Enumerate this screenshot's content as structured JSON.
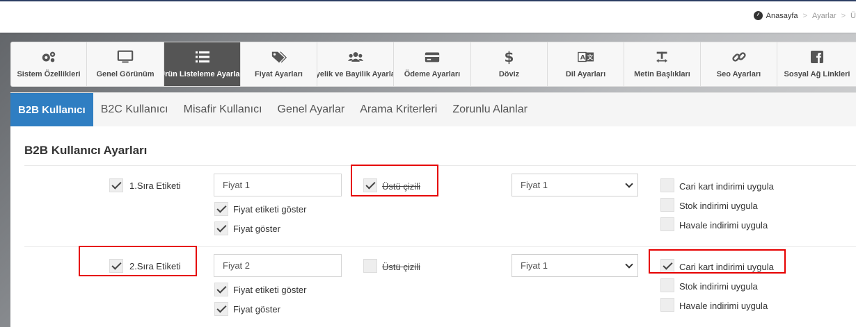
{
  "breadcrumb": {
    "home": "Anasayfa",
    "sep": ">",
    "item1": "Ayarlar",
    "item2": "Ü"
  },
  "toolbar": {
    "items": [
      {
        "label": "Sistem Özellikleri",
        "icon": "gears-icon"
      },
      {
        "label": "Genel Görünüm",
        "icon": "monitor-icon"
      },
      {
        "label": "Ürün Listeleme Ayarları",
        "icon": "list-icon"
      },
      {
        "label": "Fiyat Ayarları",
        "icon": "tags-icon"
      },
      {
        "label": "Üyelik ve Bayilik Ayarları",
        "icon": "users-icon"
      },
      {
        "label": "Ödeme Ayarları",
        "icon": "credit-card-icon"
      },
      {
        "label": "Döviz",
        "icon": "dollar-icon"
      },
      {
        "label": "Dil Ayarları",
        "icon": "language-icon"
      },
      {
        "label": "Metin Başlıkları",
        "icon": "text-height-icon"
      },
      {
        "label": "Seo Ayarları",
        "icon": "link-icon"
      },
      {
        "label": "Sosyal Ağ Linkleri",
        "icon": "facebook-icon"
      }
    ],
    "active_index": 2
  },
  "tabs": [
    "B2B Kullanıcı",
    "B2C Kullanıcı",
    "Misafir Kullanıcı",
    "Genel Ayarlar",
    "Arama Kriterleri",
    "Zorunlu Alanlar"
  ],
  "section_title": "B2B Kullanıcı Ayarları",
  "rows": [
    {
      "label_check": {
        "label": "1.Sıra Etiketi",
        "checked": true
      },
      "input_value": "Fiyat 1",
      "show_label": {
        "label": "Fiyat etiketi göster",
        "checked": true
      },
      "show_price": {
        "label": "Fiyat göster",
        "checked": true
      },
      "strike": {
        "label": "Üstü çizili",
        "checked": true
      },
      "select_value": "Fiyat 1",
      "discounts": [
        {
          "label": "Cari kart indirimi uygula",
          "checked": false
        },
        {
          "label": "Stok indirimi uygula",
          "checked": false
        },
        {
          "label": "Havale indirimi uygula",
          "checked": false
        }
      ]
    },
    {
      "label_check": {
        "label": "2.Sıra Etiketi",
        "checked": true
      },
      "input_value": "Fiyat 2",
      "show_label": {
        "label": "Fiyat etiketi göster",
        "checked": true
      },
      "show_price": {
        "label": "Fiyat göster",
        "checked": true
      },
      "strike": {
        "label": "Üstü çizili",
        "checked": false
      },
      "select_value": "Fiyat 1",
      "discounts": [
        {
          "label": "Cari kart indirimi uygula",
          "checked": true
        },
        {
          "label": "Stok indirimi uygula",
          "checked": false
        },
        {
          "label": "Havale indirimi uygula",
          "checked": false
        }
      ]
    }
  ],
  "colors": {
    "active_tab": "#2f7ec2",
    "active_tool": "#555555",
    "highlight": "#e60000",
    "top_border": "#2c3e63"
  }
}
